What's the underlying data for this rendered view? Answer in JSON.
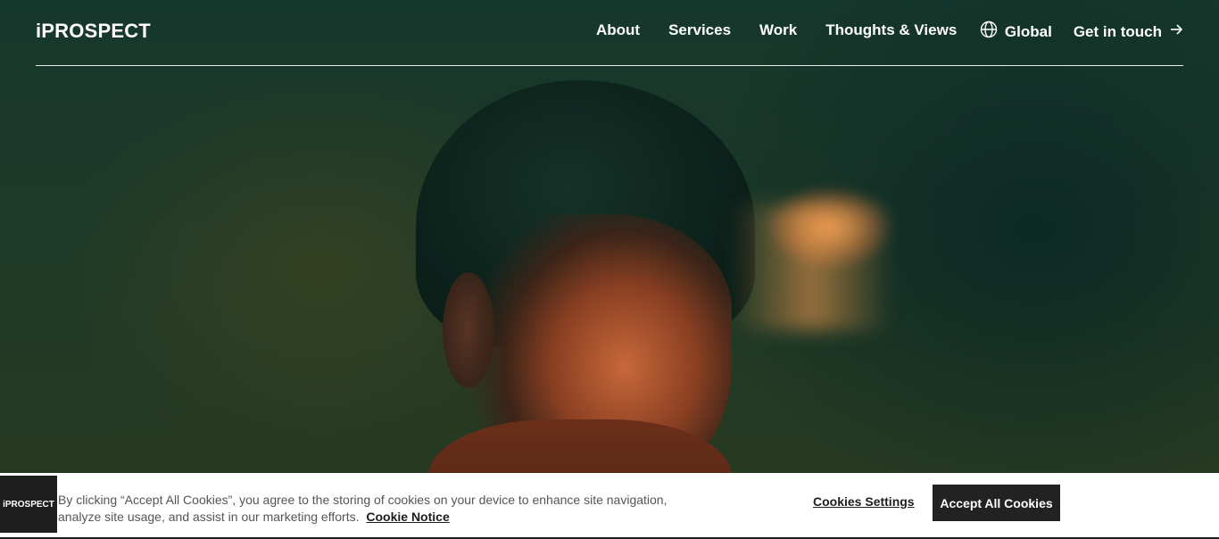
{
  "header": {
    "logo": "iPROSPECT",
    "nav": [
      "About",
      "Services",
      "Work",
      "Thoughts & Views"
    ],
    "global_label": "Global",
    "cta_label": "Get in touch"
  },
  "cookie_banner": {
    "logo": "iPROSPECT",
    "text": "By clicking “Accept All Cookies”, you agree to the storing of cookies on your device to enhance site navigation, analyze site usage, and assist in our marketing efforts.",
    "notice_link": "Cookie Notice",
    "settings_label": "Cookies Settings",
    "accept_label": "Accept All Cookies"
  },
  "icons": {
    "globe": "globe-icon",
    "arrow": "arrow-right-icon"
  }
}
